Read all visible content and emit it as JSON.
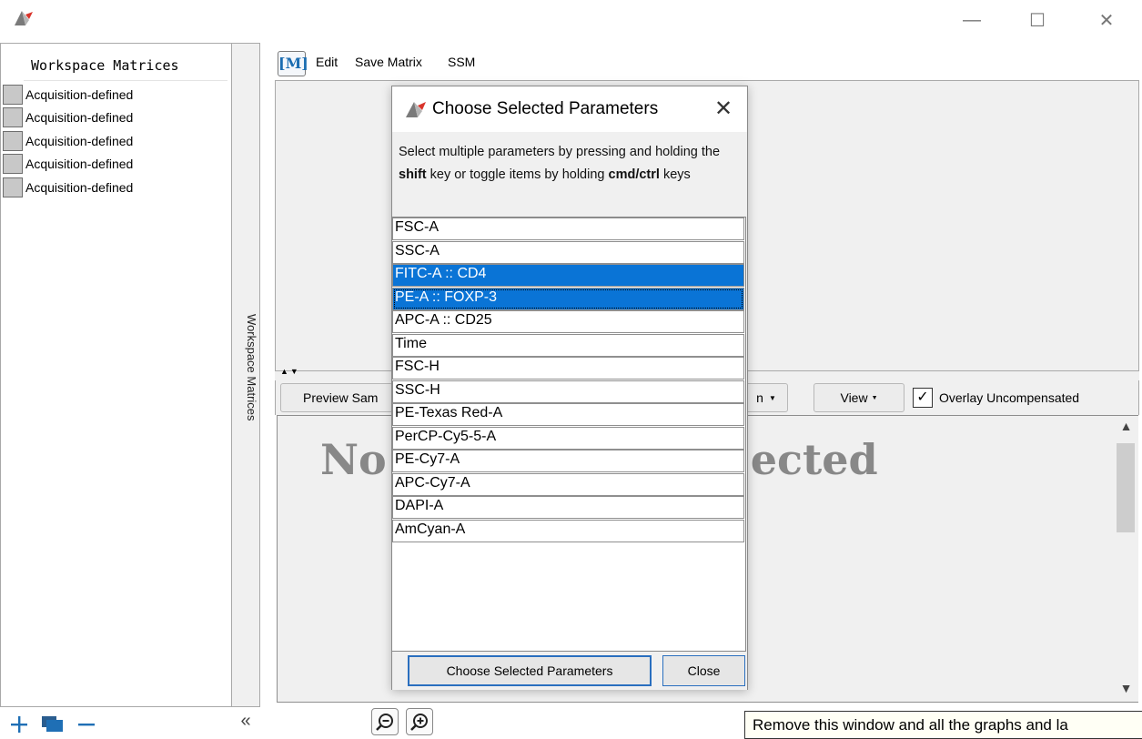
{
  "window": {
    "minimize_glyph": "—",
    "maximize_glyph": "☐",
    "close_glyph": "✕"
  },
  "left_panel": {
    "header": "Workspace Matrices",
    "items": [
      {
        "label": "Acquisition-defined"
      },
      {
        "label": "Acquisition-defined"
      },
      {
        "label": "Acquisition-defined"
      },
      {
        "label": "Acquisition-defined"
      },
      {
        "label": "Acquisition-defined"
      }
    ],
    "vertical_tab_label": "Workspace Matrices",
    "collapse_glyph": "«",
    "bottom_icons": [
      "plus-icon",
      "matrix-icon",
      "minus-icon"
    ]
  },
  "toolbar": {
    "m_label": "M",
    "edit": "Edit",
    "save_matrix": "Save Matrix",
    "ssm": "SSM"
  },
  "preview": {
    "preview_sample_label": "Preview Sam",
    "hidden_button_tail": "n",
    "view_label": "View",
    "overlay_label": "Overlay Uncompensated",
    "overlay_checked": true,
    "background_text_left": "No",
    "background_text_right": "ected"
  },
  "dialog": {
    "title": "Choose Selected Parameters",
    "instructions": {
      "part1": "Select multiple parameters by pressing and holding the ",
      "bold1": "shift",
      "part2": " key or toggle items by holding ",
      "bold2": "cmd/ctrl",
      "part3": " keys"
    },
    "parameters": [
      {
        "label": "FSC-A",
        "selected": false
      },
      {
        "label": "SSC-A",
        "selected": false
      },
      {
        "label": "FITC-A :: CD4",
        "selected": true
      },
      {
        "label": "PE-A :: FOXP-3",
        "selected": true
      },
      {
        "label": "APC-A :: CD25",
        "selected": false
      },
      {
        "label": "Time",
        "selected": false
      },
      {
        "label": "FSC-H",
        "selected": false
      },
      {
        "label": "SSC-H",
        "selected": false
      },
      {
        "label": "PE-Texas Red-A",
        "selected": false
      },
      {
        "label": "PerCP-Cy5-5-A",
        "selected": false
      },
      {
        "label": "PE-Cy7-A",
        "selected": false
      },
      {
        "label": "APC-Cy7-A",
        "selected": false
      },
      {
        "label": "DAPI-A",
        "selected": false
      },
      {
        "label": "AmCyan-A",
        "selected": false
      }
    ],
    "choose_button": "Choose Selected Parameters",
    "close_button": "Close"
  },
  "tooltip": "Remove this window and all the graphs and la",
  "colors": {
    "selection": "#0a74d6",
    "accent_icon": "#1f6fb5",
    "logo_red": "#d9342b"
  }
}
